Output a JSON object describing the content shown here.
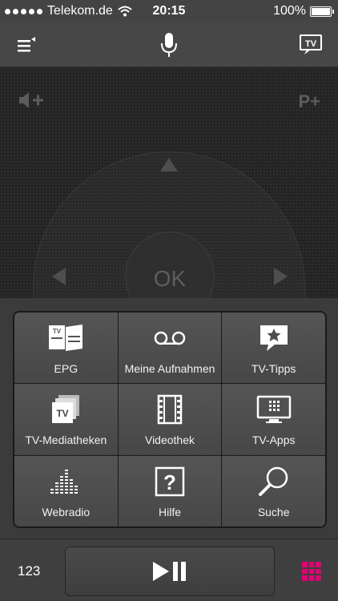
{
  "status_bar": {
    "carrier": "Telekom.de",
    "time": "20:15",
    "battery": "100%",
    "signal_bars": 5
  },
  "top_bar": {
    "menu_icon": "menu-icon",
    "mic_icon": "microphone-icon",
    "tv_icon": "tv-icon",
    "tv_icon_text": "TV"
  },
  "pad": {
    "volume_label": "◀+",
    "program_label": "P+",
    "ok_label": "OK"
  },
  "menu": {
    "items": [
      {
        "label": "EPG",
        "icon": "epg-icon"
      },
      {
        "label": "Meine Aufnahmen",
        "icon": "recording-icon"
      },
      {
        "label": "TV-Tipps",
        "icon": "tv-tips-star-icon"
      },
      {
        "label": "TV-Mediatheken",
        "icon": "tv-library-icon"
      },
      {
        "label": "Videothek",
        "icon": "film-icon"
      },
      {
        "label": "TV-Apps",
        "icon": "tv-apps-icon"
      },
      {
        "label": "Webradio",
        "icon": "equalizer-icon"
      },
      {
        "label": "Hilfe",
        "icon": "help-icon"
      },
      {
        "label": "Suche",
        "icon": "search-icon"
      }
    ]
  },
  "bottom_bar": {
    "numpad_label": "123",
    "play_pause_icon": "play-pause-icon",
    "color_keys_icon": "magenta-grid-icon",
    "accent": "#e20074"
  }
}
